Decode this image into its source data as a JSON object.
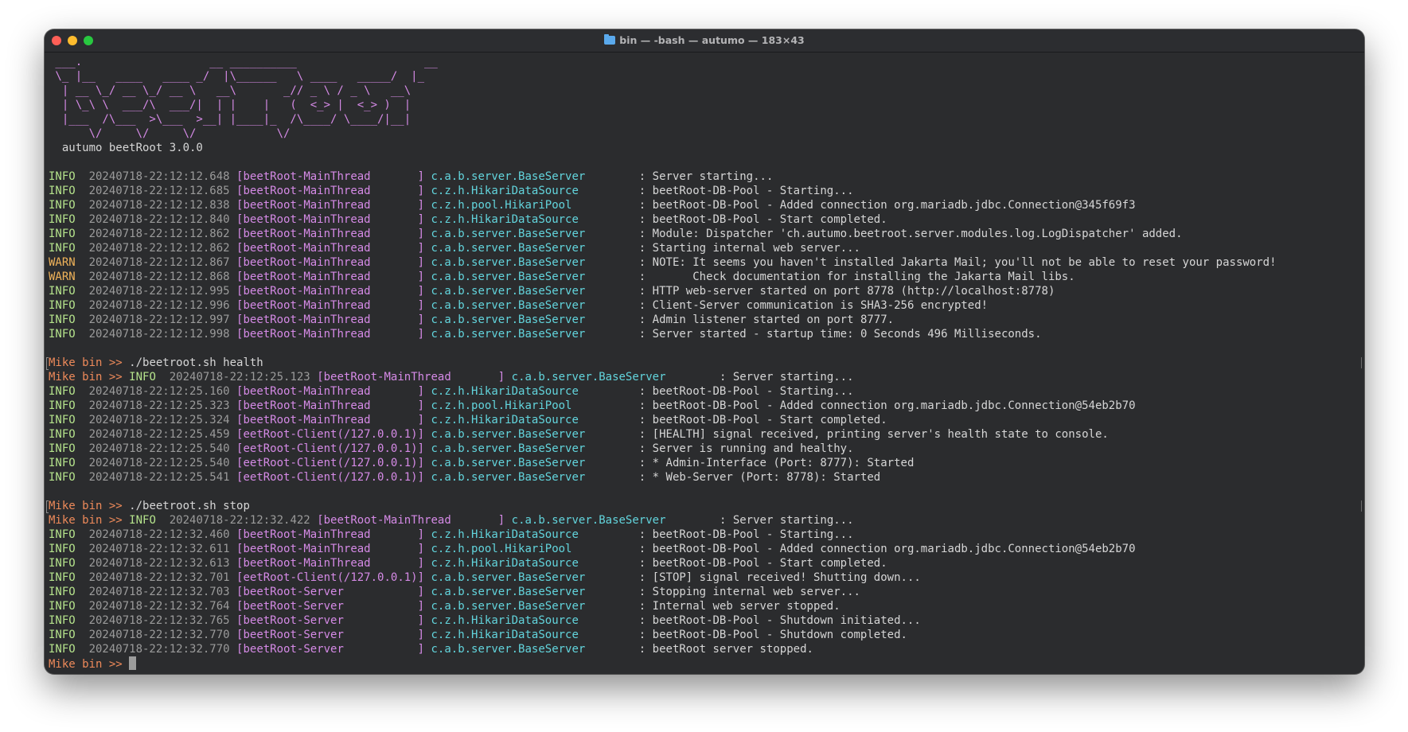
{
  "window": {
    "title": "bin — -bash — autumo — 183×43",
    "folder_icon": "folder-icon"
  },
  "banner": {
    "ascii": [
      " ___.                   __ __________                   __    ",
      " \\_ |__   ____   ____ _/  |\\______   \\ ____   _____/  |_  ",
      "  | __ \\_/ __ \\_/ __ \\   __\\       _// _ \\ / _ \\   __\\ ",
      "  | \\_\\ \\  ___/\\  ___/|  | |    |   (  <_> |  <_> )  |   ",
      "  |___  /\\___  >\\___  >__| |____|_  /\\____/ \\____/|__|   ",
      "      \\/     \\/     \\/            \\/                      "
    ],
    "version": "  autumo beetRoot 3.0.0"
  },
  "prompt": "Mike bin >> ",
  "blocks": [
    {
      "command": "",
      "logs": [
        {
          "level": "INFO",
          "ts": "20240718-22:12:12.648",
          "thread": "[beetRoot-MainThread       ]",
          "cls": "c.a.b.server.BaseServer",
          "msg": "Server starting..."
        },
        {
          "level": "INFO",
          "ts": "20240718-22:12:12.685",
          "thread": "[beetRoot-MainThread       ]",
          "cls": "c.z.h.HikariDataSource",
          "msg": "beetRoot-DB-Pool - Starting..."
        },
        {
          "level": "INFO",
          "ts": "20240718-22:12:12.838",
          "thread": "[beetRoot-MainThread       ]",
          "cls": "c.z.h.pool.HikariPool",
          "msg": "beetRoot-DB-Pool - Added connection org.mariadb.jdbc.Connection@345f69f3"
        },
        {
          "level": "INFO",
          "ts": "20240718-22:12:12.840",
          "thread": "[beetRoot-MainThread       ]",
          "cls": "c.z.h.HikariDataSource",
          "msg": "beetRoot-DB-Pool - Start completed."
        },
        {
          "level": "INFO",
          "ts": "20240718-22:12:12.862",
          "thread": "[beetRoot-MainThread       ]",
          "cls": "c.a.b.server.BaseServer",
          "msg": "Module: Dispatcher 'ch.autumo.beetroot.server.modules.log.LogDispatcher' added."
        },
        {
          "level": "INFO",
          "ts": "20240718-22:12:12.862",
          "thread": "[beetRoot-MainThread       ]",
          "cls": "c.a.b.server.BaseServer",
          "msg": "Starting internal web server..."
        },
        {
          "level": "WARN",
          "ts": "20240718-22:12:12.867",
          "thread": "[beetRoot-MainThread       ]",
          "cls": "c.a.b.server.BaseServer",
          "msg": "NOTE: It seems you haven't installed Jakarta Mail; you'll not be able to reset your password!"
        },
        {
          "level": "WARN",
          "ts": "20240718-22:12:12.868",
          "thread": "[beetRoot-MainThread       ]",
          "cls": "c.a.b.server.BaseServer",
          "msg": "      Check documentation for installing the Jakarta Mail libs."
        },
        {
          "level": "INFO",
          "ts": "20240718-22:12:12.995",
          "thread": "[beetRoot-MainThread       ]",
          "cls": "c.a.b.server.BaseServer",
          "msg": "HTTP web-server started on port 8778 (http://localhost:8778)"
        },
        {
          "level": "INFO",
          "ts": "20240718-22:12:12.996",
          "thread": "[beetRoot-MainThread       ]",
          "cls": "c.a.b.server.BaseServer",
          "msg": "Client-Server communication is SHA3-256 encrypted!"
        },
        {
          "level": "INFO",
          "ts": "20240718-22:12:12.997",
          "thread": "[beetRoot-MainThread       ]",
          "cls": "c.a.b.server.BaseServer",
          "msg": "Admin listener started on port 8777."
        },
        {
          "level": "INFO",
          "ts": "20240718-22:12:12.998",
          "thread": "[beetRoot-MainThread       ]",
          "cls": "c.a.b.server.BaseServer",
          "msg": "Server started - startup time: 0 Seconds 496 Milliseconds."
        }
      ]
    },
    {
      "command": "./beetroot.sh health",
      "logs": [
        {
          "level": "INFO",
          "ts": "20240718-22:12:25.123",
          "thread": "[beetRoot-MainThread       ]",
          "cls": "c.a.b.server.BaseServer",
          "msg": "Server starting..."
        },
        {
          "level": "INFO",
          "ts": "20240718-22:12:25.160",
          "thread": "[beetRoot-MainThread       ]",
          "cls": "c.z.h.HikariDataSource",
          "msg": "beetRoot-DB-Pool - Starting..."
        },
        {
          "level": "INFO",
          "ts": "20240718-22:12:25.323",
          "thread": "[beetRoot-MainThread       ]",
          "cls": "c.z.h.pool.HikariPool",
          "msg": "beetRoot-DB-Pool - Added connection org.mariadb.jdbc.Connection@54eb2b70"
        },
        {
          "level": "INFO",
          "ts": "20240718-22:12:25.324",
          "thread": "[beetRoot-MainThread       ]",
          "cls": "c.z.h.HikariDataSource",
          "msg": "beetRoot-DB-Pool - Start completed."
        },
        {
          "level": "INFO",
          "ts": "20240718-22:12:25.459",
          "thread": "[eetRoot-Client(/127.0.0.1)]",
          "cls": "c.a.b.server.BaseServer",
          "msg": "[HEALTH] signal received, printing server's health state to console."
        },
        {
          "level": "INFO",
          "ts": "20240718-22:12:25.540",
          "thread": "[eetRoot-Client(/127.0.0.1)]",
          "cls": "c.a.b.server.BaseServer",
          "msg": "Server is running and healthy."
        },
        {
          "level": "INFO",
          "ts": "20240718-22:12:25.540",
          "thread": "[eetRoot-Client(/127.0.0.1)]",
          "cls": "c.a.b.server.BaseServer",
          "msg": "* Admin-Interface (Port: 8777): Started"
        },
        {
          "level": "INFO",
          "ts": "20240718-22:12:25.541",
          "thread": "[eetRoot-Client(/127.0.0.1)]",
          "cls": "c.a.b.server.BaseServer",
          "msg": "* Web-Server (Port: 8778): Started"
        }
      ]
    },
    {
      "command": "./beetroot.sh stop",
      "logs": [
        {
          "level": "INFO",
          "ts": "20240718-22:12:32.422",
          "thread": "[beetRoot-MainThread       ]",
          "cls": "c.a.b.server.BaseServer",
          "msg": "Server starting..."
        },
        {
          "level": "INFO",
          "ts": "20240718-22:12:32.460",
          "thread": "[beetRoot-MainThread       ]",
          "cls": "c.z.h.HikariDataSource",
          "msg": "beetRoot-DB-Pool - Starting..."
        },
        {
          "level": "INFO",
          "ts": "20240718-22:12:32.611",
          "thread": "[beetRoot-MainThread       ]",
          "cls": "c.z.h.pool.HikariPool",
          "msg": "beetRoot-DB-Pool - Added connection org.mariadb.jdbc.Connection@54eb2b70"
        },
        {
          "level": "INFO",
          "ts": "20240718-22:12:32.613",
          "thread": "[beetRoot-MainThread       ]",
          "cls": "c.z.h.HikariDataSource",
          "msg": "beetRoot-DB-Pool - Start completed."
        },
        {
          "level": "INFO",
          "ts": "20240718-22:12:32.701",
          "thread": "[eetRoot-Client(/127.0.0.1)]",
          "cls": "c.a.b.server.BaseServer",
          "msg": "[STOP] signal received! Shutting down..."
        },
        {
          "level": "INFO",
          "ts": "20240718-22:12:32.703",
          "thread": "[beetRoot-Server           ]",
          "cls": "c.a.b.server.BaseServer",
          "msg": "Stopping internal web server..."
        },
        {
          "level": "INFO",
          "ts": "20240718-22:12:32.764",
          "thread": "[beetRoot-Server           ]",
          "cls": "c.a.b.server.BaseServer",
          "msg": "Internal web server stopped."
        },
        {
          "level": "INFO",
          "ts": "20240718-22:12:32.765",
          "thread": "[beetRoot-Server           ]",
          "cls": "c.z.h.HikariDataSource",
          "msg": "beetRoot-DB-Pool - Shutdown initiated..."
        },
        {
          "level": "INFO",
          "ts": "20240718-22:12:32.770",
          "thread": "[beetRoot-Server           ]",
          "cls": "c.z.h.HikariDataSource",
          "msg": "beetRoot-DB-Pool - Shutdown completed."
        },
        {
          "level": "INFO",
          "ts": "20240718-22:12:32.770",
          "thread": "[beetRoot-Server           ]",
          "cls": "c.a.b.server.BaseServer",
          "msg": "beetRoot server stopped."
        }
      ]
    }
  ],
  "colors": {
    "info": "#b5e38c",
    "warn": "#f0b35a",
    "thread": "#d58ae6",
    "class": "#62d4dc",
    "prompt": "#ee8a5a"
  }
}
